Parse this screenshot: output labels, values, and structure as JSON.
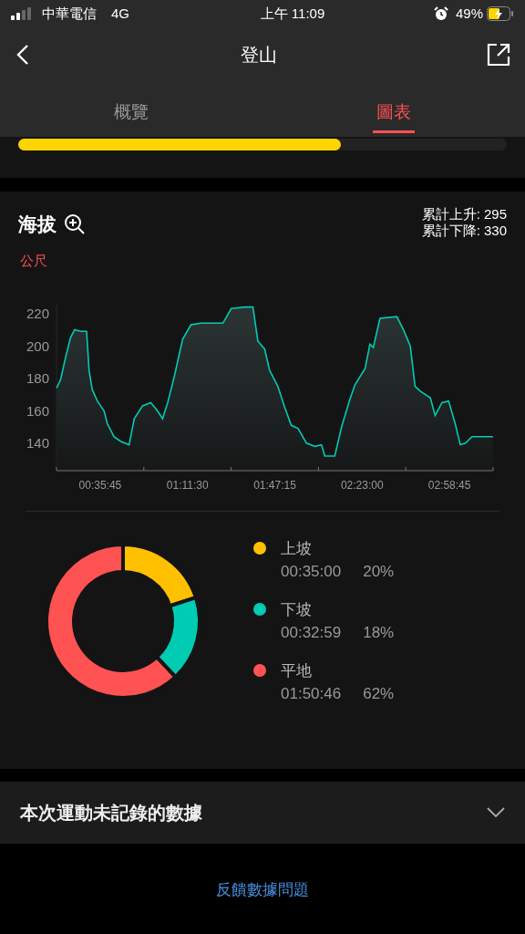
{
  "status_bar": {
    "carrier": "中華電信",
    "network": "4G",
    "time": "上午 11:09",
    "battery": "49%"
  },
  "nav": {
    "title": "登山"
  },
  "tabs": [
    {
      "label": "概覽",
      "selected": false
    },
    {
      "label": "圖表",
      "selected": true
    }
  ],
  "progress": {
    "level": 0.66
  },
  "elevation": {
    "title": "海拔",
    "ascent": "累計上升: 295",
    "descent": "累計下降: 330",
    "unit": "公尺",
    "chart_data": {
      "type": "area",
      "ylim": [
        125,
        228
      ],
      "xlim": [
        17.875,
        196.625
      ],
      "yticks": [
        140,
        160,
        180,
        200,
        220
      ],
      "xticks": [
        {
          "value": 35.75,
          "label": "00:35:45"
        },
        {
          "value": 71.5,
          "label": "01:11:30"
        },
        {
          "value": 107.25,
          "label": "01:47:15"
        },
        {
          "value": 143,
          "label": "02:23:00"
        },
        {
          "value": 178.75,
          "label": "02:58:45"
        }
      ],
      "x": [
        17.9,
        19.5,
        21.6,
        23.6,
        25.3,
        27.7,
        30.2,
        31.2,
        32.5,
        34.6,
        37.3,
        38.7,
        41.4,
        44.2,
        47.6,
        49.7,
        53.1,
        56.5,
        59.2,
        61.3,
        63.4,
        66.1,
        69.5,
        72.9,
        77.0,
        86.0,
        89.4,
        94.9,
        98.3,
        100.3,
        103.1,
        105.1,
        108.5,
        111.3,
        114.0,
        116.8,
        120.2,
        123.6,
        126.4,
        127.7,
        131.8,
        134.6,
        138.0,
        140.1,
        144.2,
        146.2,
        147.6,
        150.3,
        157.2,
        159.9,
        162.7,
        164.7,
        166.8,
        170.9,
        172.9,
        175.7,
        178.4,
        181.1,
        183.2,
        185.3,
        188.0,
        192.1,
        196.6
      ],
      "series": [
        {
          "color": "#00ccb4",
          "values": [
            176,
            181,
            195,
            207,
            212,
            211,
            211,
            187,
            175,
            168,
            162,
            154,
            146,
            143,
            141,
            157,
            165,
            167,
            162,
            157,
            167,
            183,
            206,
            215,
            216,
            216,
            225,
            226,
            226,
            205,
            200,
            187,
            177,
            164,
            153,
            151,
            142,
            140,
            141,
            134,
            134,
            152,
            169,
            178,
            188,
            203,
            201,
            219,
            220,
            212,
            202,
            177,
            174,
            170,
            159,
            167,
            168,
            154,
            141,
            142,
            146,
            146,
            146
          ]
        }
      ]
    }
  },
  "terrain": {
    "chart_data": {
      "type": "donut",
      "categories": [
        "上坡",
        "下坡",
        "平地"
      ],
      "values": [
        20,
        18,
        62
      ]
    },
    "legend": [
      {
        "duration": "00:35:00",
        "percent": "20%",
        "color": "#ffc000"
      },
      {
        "duration": "00:32:59",
        "percent": "18%",
        "color": "#00ccb4"
      },
      {
        "duration": "01:50:46",
        "percent": "62%",
        "color": "#ff5252"
      }
    ]
  },
  "unrecorded": {
    "title": "本次運動未記錄的數據",
    "expanded": false
  },
  "feedback_link": "反饋數據問題"
}
